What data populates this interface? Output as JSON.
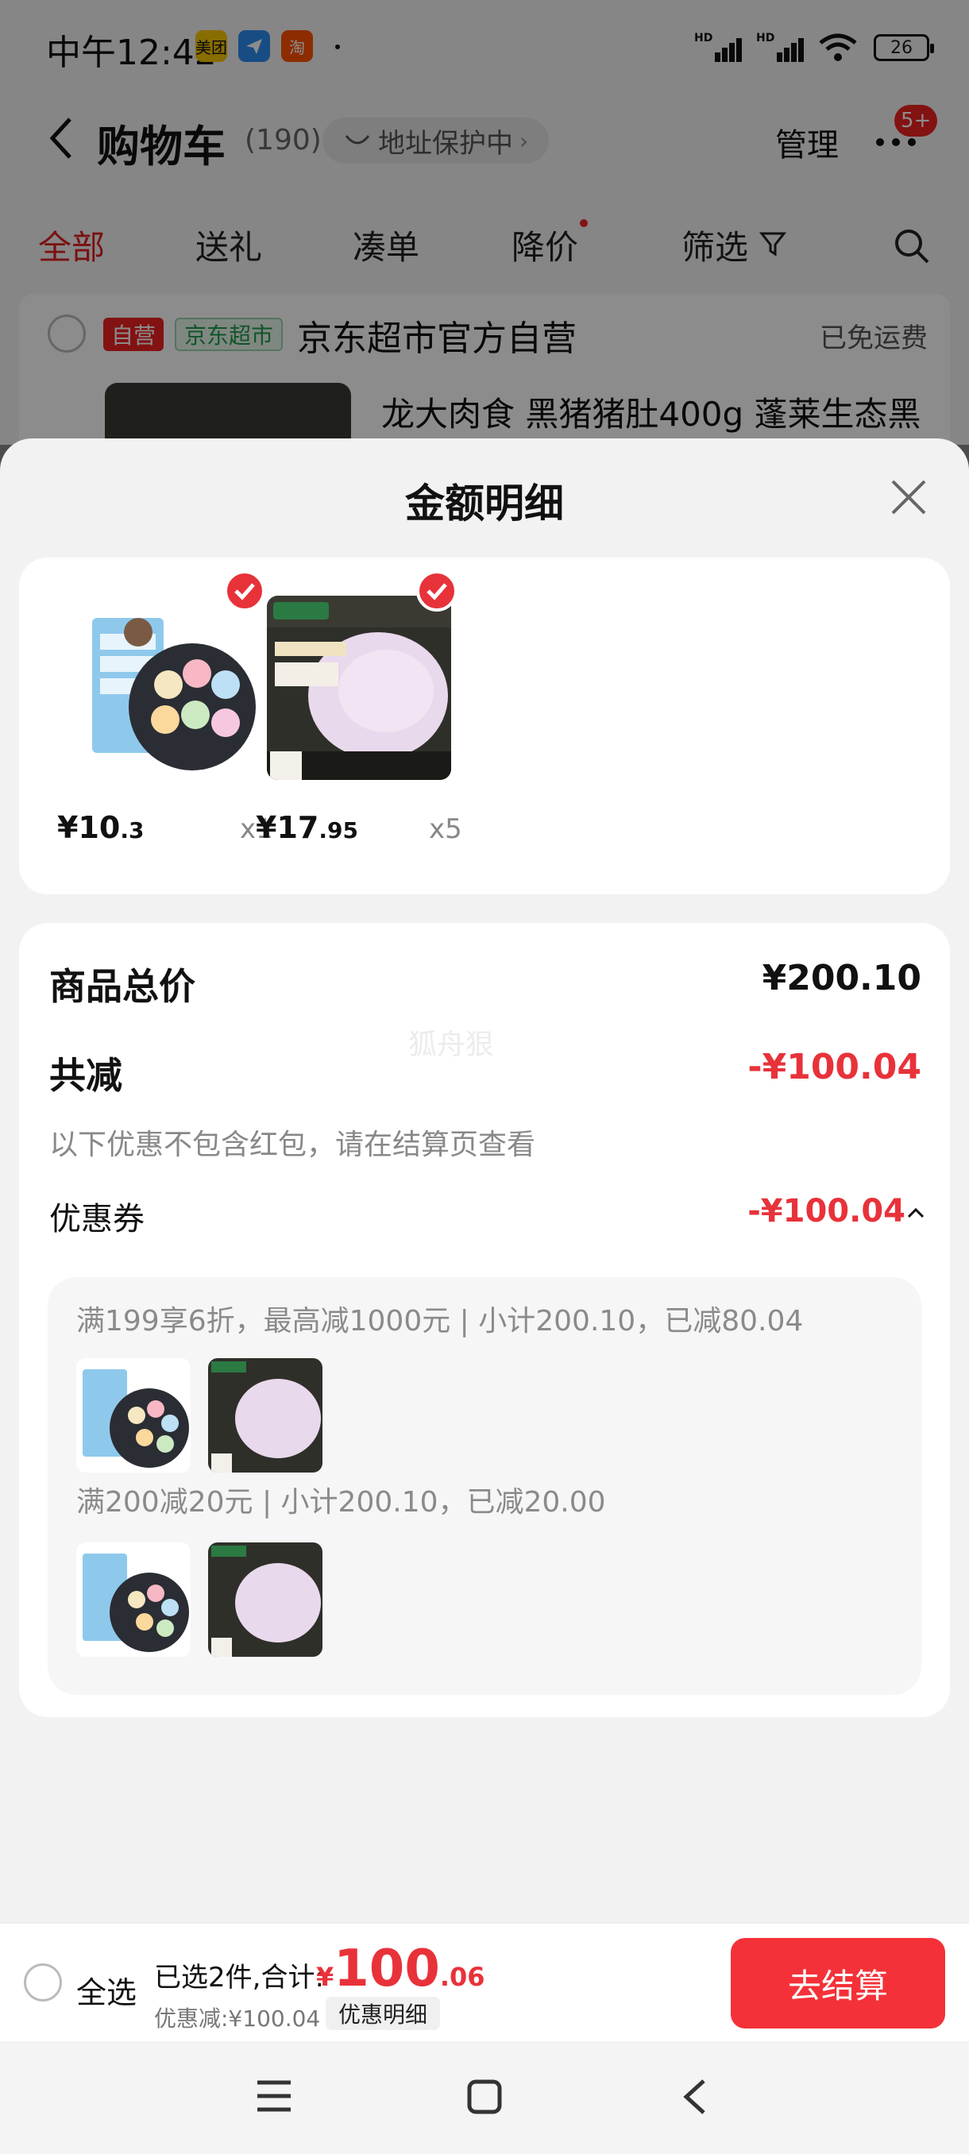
{
  "status_bar": {
    "time": "中午12:42",
    "apps": [
      "美团",
      "",
      "淘"
    ],
    "battery": "26"
  },
  "header": {
    "title": "购物车",
    "count": "(190)",
    "address": "地址保护中",
    "manage": "管理",
    "badge": "5+"
  },
  "tabs": [
    "全部",
    "送礼",
    "凑单",
    "降价",
    "筛选"
  ],
  "store": {
    "tag_self": "自营",
    "tag_market": "京东超市",
    "name": "京东超市官方自营",
    "shipping": "已免运费",
    "product_title": "龙大肉食 黑猪猪肚400g 蓬莱生态黑"
  },
  "sheet": {
    "title": "金额明细",
    "items": [
      {
        "price_int": "¥10",
        "price_dec": ".3",
        "qty": "x1"
      },
      {
        "price_int": "¥17",
        "price_dec": ".95",
        "qty": "x5"
      }
    ],
    "total_label": "商品总价",
    "total_value": "¥200.10",
    "discount_label": "共减",
    "discount_value": "-¥100.04",
    "note": "以下优惠不包含红包，请在结算页查看",
    "coupon_label": "优惠券",
    "coupon_value": "-¥100.04",
    "watermark": "狐舟狠",
    "promos": [
      {
        "text": "满199享6折，最高减1000元 | 小计200.10，已减80.04"
      },
      {
        "text": "满200减20元 | 小计200.10，已减20.00"
      }
    ]
  },
  "checkout": {
    "select_all": "全选",
    "selected": "已选2件,合计:",
    "currency": "¥",
    "total_int": "100",
    "total_dec": ".06",
    "discount": "优惠减:¥100.04",
    "detail_button": "优惠明细",
    "checkout_button": "去结算"
  },
  "colors": {
    "accent": "#e8323a",
    "button": "#f43138"
  }
}
